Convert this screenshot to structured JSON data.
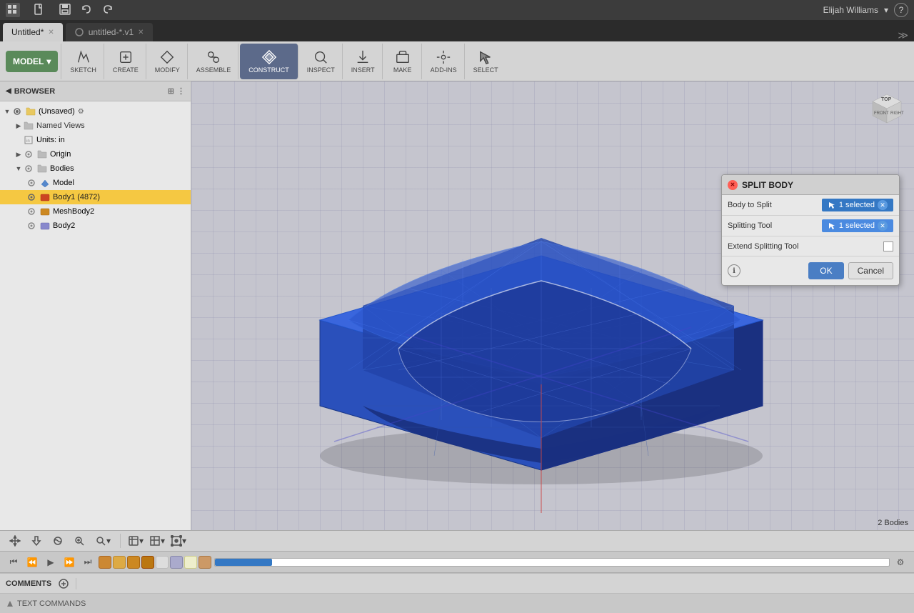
{
  "titlebar": {
    "app_grid_icon": "grid-icon",
    "file_menu": "File",
    "save_icon": "save-icon",
    "undo_icon": "undo-icon",
    "redo_icon": "redo-icon",
    "user": "Elijah Williams",
    "help_icon": "help-icon"
  },
  "tabs": [
    {
      "label": "Untitled*",
      "active": true
    },
    {
      "label": "untitled-*.v1",
      "active": false
    }
  ],
  "toolbar": {
    "model_label": "MODEL",
    "sketch_label": "SKETCH",
    "create_label": "CREATE",
    "modify_label": "MODIFY",
    "assemble_label": "ASSEMBLE",
    "construct_label": "CONSTRUCT",
    "inspect_label": "INSPECT",
    "insert_label": "INSERT",
    "make_label": "MAKE",
    "addins_label": "ADD-INS",
    "select_label": "SELECT"
  },
  "sidebar": {
    "header": "BROWSER",
    "root_label": "(Unsaved)",
    "named_views_label": "Named Views",
    "units_label": "Units: in",
    "origin_label": "Origin",
    "bodies_label": "Bodies",
    "model_label": "Model",
    "body1_label": "Body1 (4872)",
    "meshbody2_label": "MeshBody2",
    "body2_label": "Body2"
  },
  "split_dialog": {
    "title": "SPLIT BODY",
    "body_to_split_label": "Body to Split",
    "body_to_split_value": "1 selected",
    "splitting_tool_label": "Splitting Tool",
    "splitting_tool_value": "1 selected",
    "extend_label": "Extend Splitting Tool",
    "ok_label": "OK",
    "cancel_label": "Cancel"
  },
  "viewport": {
    "status": "2 Bodies"
  },
  "comments": {
    "label": "COMMENTS",
    "add_icon": "+"
  },
  "text_commands": {
    "label": "TEXT COMMANDS"
  }
}
